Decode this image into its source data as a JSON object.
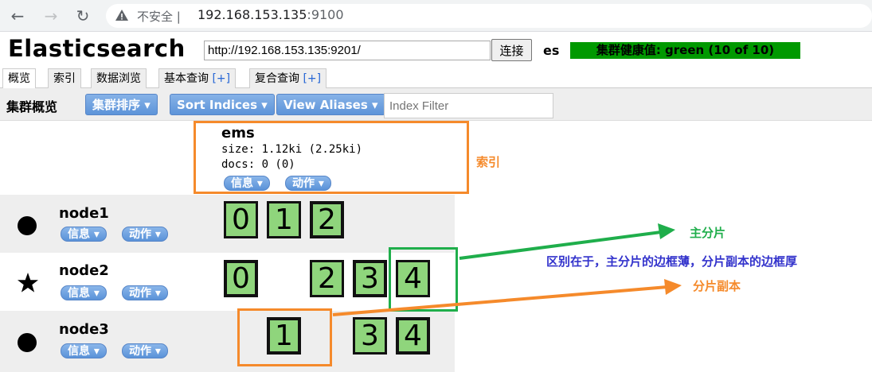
{
  "browser": {
    "security_label": "不安全",
    "url_host": "192.168.153.135",
    "url_port": ":9100"
  },
  "app": {
    "title": "Elasticsearch",
    "connection_url": "http://192.168.153.135:9201/",
    "connect_label": "连接",
    "cluster_name": "es",
    "cluster_health": "集群健康值: green (10 of 10)",
    "health_color": "#009900"
  },
  "tabs": [
    {
      "label": "概览",
      "plus": ""
    },
    {
      "label": "索引",
      "plus": ""
    },
    {
      "label": "数据浏览",
      "plus": ""
    },
    {
      "label": "基本查询 ",
      "plus": "[+]"
    },
    {
      "label": "复合查询 ",
      "plus": "[+]"
    }
  ],
  "toolbar": {
    "title": "集群概览",
    "sort_cluster": "集群排序 ▾",
    "sort_indices": "Sort Indices ▾",
    "view_aliases": "View Aliases ▾",
    "index_filter_placeholder": "Index Filter"
  },
  "index": {
    "name": "ems",
    "size": "size: 1.12ki (2.25ki)",
    "docs": "docs: 0 (0)",
    "info_label": "信息 ▾",
    "action_label": "动作 ▾"
  },
  "nodes": [
    {
      "name": "node1",
      "icon": "circle",
      "info": "信息 ▾",
      "action": "动作 ▾",
      "shards": [
        {
          "n": "0",
          "primary": false
        },
        {
          "n": "1",
          "primary": false
        },
        {
          "n": "2",
          "primary": true
        }
      ]
    },
    {
      "name": "node2",
      "icon": "star",
      "info": "信息 ▾",
      "action": "动作 ▾",
      "shards": [
        {
          "n": "0",
          "primary": true
        },
        {
          "n": "2",
          "primary": false
        },
        {
          "n": "3",
          "primary": true
        },
        {
          "n": "4",
          "primary": false
        }
      ]
    },
    {
      "name": "node3",
      "icon": "circle",
      "info": "信息 ▾",
      "action": "动作 ▾",
      "shards": [
        {
          "n": "1",
          "primary": true
        },
        {
          "n": "3",
          "primary": false
        },
        {
          "n": "4",
          "primary": true
        }
      ]
    }
  ],
  "annotations": {
    "index_label": "索引",
    "primary_label": "主分片",
    "difference": "区别在于，主分片的边框薄，分片副本的边框厚",
    "replica_label": "分片副本",
    "orange": "#f58a2b",
    "green": "#1fae4b",
    "blue_text": "#3333cc"
  }
}
